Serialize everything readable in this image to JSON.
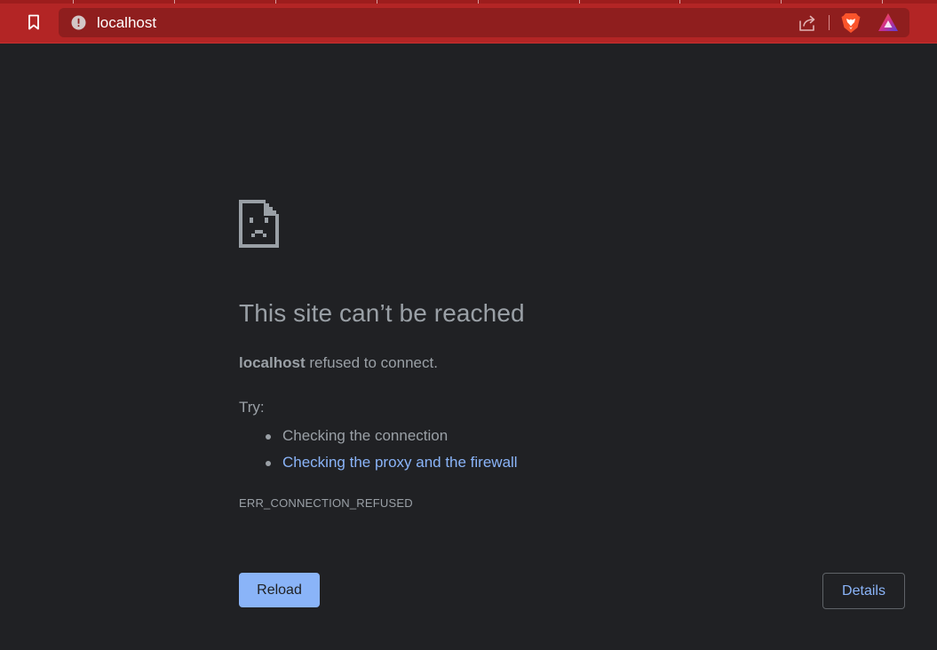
{
  "browser": {
    "url": "localhost",
    "theme_color": "#b32525",
    "omnibox_color": "#8f1e1e",
    "icons": {
      "bookmark": "bookmark-icon",
      "site_info": "info-icon",
      "share": "share-icon",
      "brave_shields": "brave-lion-icon",
      "rewards": "brave-rewards-icon"
    }
  },
  "error_page": {
    "icon": "sad-document-icon",
    "title": "This site can’t be reached",
    "message": {
      "host": "localhost",
      "text": " refused to connect."
    },
    "try_label": "Try:",
    "suggestions": [
      {
        "text": "Checking the connection",
        "is_link": false
      },
      {
        "text": "Checking the proxy and the firewall",
        "is_link": true
      }
    ],
    "error_code": "ERR_CONNECTION_REFUSED",
    "reload_label": "Reload",
    "details_label": "Details",
    "colors": {
      "background": "#202124",
      "text": "#9aa0a6",
      "link": "#8ab4f8",
      "button": "#8ab4f8"
    }
  }
}
